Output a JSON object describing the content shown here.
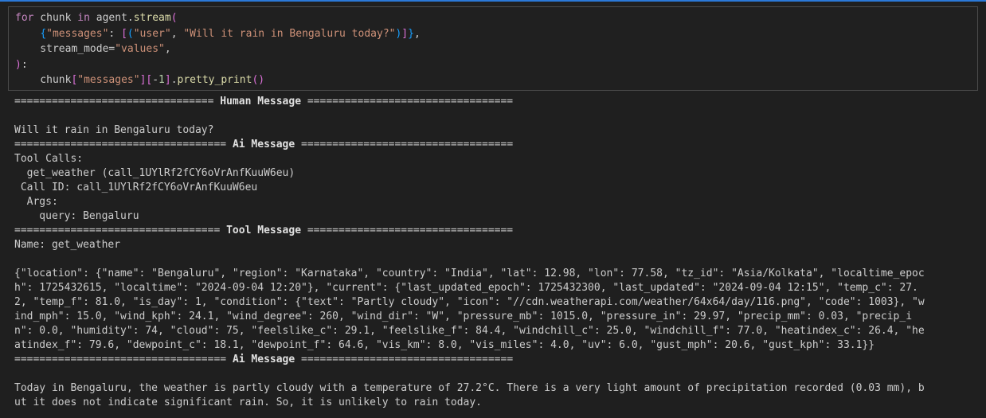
{
  "code_cell": {
    "lines": [
      [
        {
          "t": "for",
          "c": "kw2"
        },
        {
          "t": " chunk ",
          "c": ""
        },
        {
          "t": "in",
          "c": "kw2"
        },
        {
          "t": " agent.",
          "c": ""
        },
        {
          "t": "stream",
          "c": "fn"
        },
        {
          "t": "(",
          "c": "brk"
        }
      ],
      [
        {
          "t": "    ",
          "c": ""
        },
        {
          "t": "{",
          "c": "brk2"
        },
        {
          "t": "\"messages\"",
          "c": "str"
        },
        {
          "t": ": ",
          "c": ""
        },
        {
          "t": "[",
          "c": "brk"
        },
        {
          "t": "(",
          "c": "brk2"
        },
        {
          "t": "\"user\"",
          "c": "str"
        },
        {
          "t": ", ",
          "c": ""
        },
        {
          "t": "\"Will it rain in Bengaluru today?\"",
          "c": "str"
        },
        {
          "t": ")",
          "c": "brk2"
        },
        {
          "t": "]",
          "c": "brk"
        },
        {
          "t": "}",
          "c": "brk2"
        },
        {
          "t": ",",
          "c": ""
        }
      ],
      [
        {
          "t": "    stream_mode",
          "c": ""
        },
        {
          "t": "=",
          "c": "op"
        },
        {
          "t": "\"values\"",
          "c": "str"
        },
        {
          "t": ",",
          "c": ""
        }
      ],
      [
        {
          "t": ")",
          "c": "brk"
        },
        {
          "t": ":",
          "c": ""
        }
      ],
      [
        {
          "t": "    chunk",
          "c": ""
        },
        {
          "t": "[",
          "c": "brk"
        },
        {
          "t": "\"messages\"",
          "c": "str"
        },
        {
          "t": "]",
          "c": "brk"
        },
        {
          "t": "[",
          "c": "brk"
        },
        {
          "t": "-",
          "c": "op"
        },
        {
          "t": "1",
          "c": "num"
        },
        {
          "t": "]",
          "c": "brk"
        },
        {
          "t": ".",
          "c": ""
        },
        {
          "t": "pretty_print",
          "c": "fn"
        },
        {
          "t": "()",
          "c": "brk"
        }
      ]
    ]
  },
  "output": {
    "human_header_left": "================================ ",
    "human_header_title": "Human Message",
    "human_header_right": " =================================",
    "human_text": "Will it rain in Bengaluru today?",
    "ai_header_left": "================================== ",
    "ai_header_title": "Ai Message",
    "ai_header_right": " ==================================",
    "tool_calls_label": "Tool Calls:",
    "tool_call_fn": "  get_weather (call_1UYlRf2fCY6oVrAnfKuuW6eu)",
    "tool_call_id": " Call ID: call_1UYlRf2fCY6oVrAnfKuuW6eu",
    "tool_call_args": "  Args:",
    "tool_call_query": "    query: Bengaluru",
    "tool_header_left": "================================= ",
    "tool_header_title": "Tool Message",
    "tool_header_right": " =================================",
    "tool_name": "Name: get_weather",
    "tool_result_lines": [
      "{\"location\": {\"name\": \"Bengaluru\", \"region\": \"Karnataka\", \"country\": \"India\", \"lat\": 12.98, \"lon\": 77.58, \"tz_id\": \"Asia/Kolkata\", \"localtime_epoc",
      "h\": 1725432615, \"localtime\": \"2024-09-04 12:20\"}, \"current\": {\"last_updated_epoch\": 1725432300, \"last_updated\": \"2024-09-04 12:15\", \"temp_c\": 27.",
      "2, \"temp_f\": 81.0, \"is_day\": 1, \"condition\": {\"text\": \"Partly cloudy\", \"icon\": \"//cdn.weatherapi.com/weather/64x64/day/116.png\", \"code\": 1003}, \"w",
      "ind_mph\": 15.0, \"wind_kph\": 24.1, \"wind_degree\": 260, \"wind_dir\": \"W\", \"pressure_mb\": 1015.0, \"pressure_in\": 29.97, \"precip_mm\": 0.03, \"precip_i",
      "n\": 0.0, \"humidity\": 74, \"cloud\": 75, \"feelslike_c\": 29.1, \"feelslike_f\": 84.4, \"windchill_c\": 25.0, \"windchill_f\": 77.0, \"heatindex_c\": 26.4, \"he",
      "atindex_f\": 79.6, \"dewpoint_c\": 18.1, \"dewpoint_f\": 64.6, \"vis_km\": 8.0, \"vis_miles\": 4.0, \"uv\": 6.0, \"gust_mph\": 20.6, \"gust_kph\": 33.1}}"
    ],
    "ai2_header_left": "================================== ",
    "ai2_header_title": "Ai Message",
    "ai2_header_right": " ==================================",
    "ai_answer_lines": [
      "Today in Bengaluru, the weather is partly cloudy with a temperature of 27.2°C. There is a very light amount of precipitation recorded (0.03 mm), b",
      "ut it does not indicate significant rain. So, it is unlikely to rain today."
    ]
  },
  "colors": {
    "background": "#1f1f1f",
    "accent": "#2b79d8",
    "text": "#cccccc",
    "string": "#ce9178",
    "keyword": "#c586c0",
    "function": "#dcdcaa"
  }
}
